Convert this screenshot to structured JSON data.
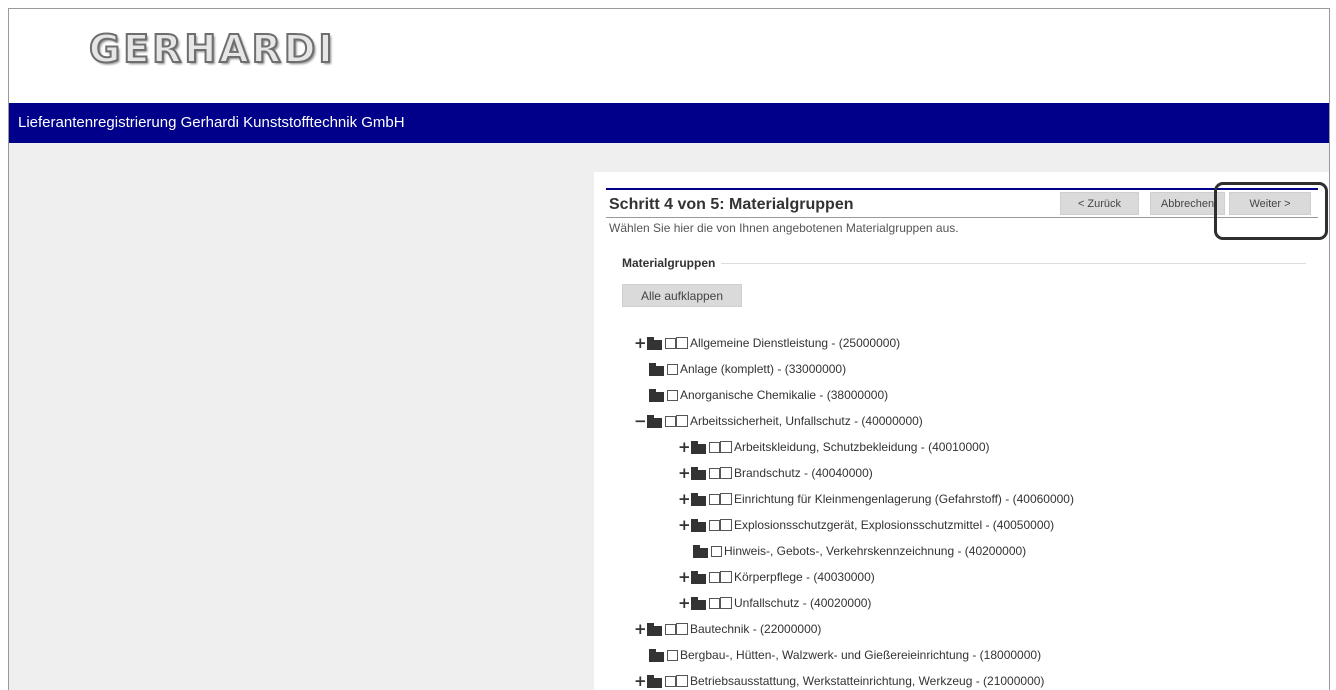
{
  "header": {
    "logo_text": "GERHARDI"
  },
  "title_bar": {
    "title": "Lieferantenregistrierung Gerhardi Kunststofftechnik GmbH"
  },
  "wizard": {
    "step_title": "Schritt 4 von 5: Materialgruppen",
    "description": "Wählen Sie hier die von Ihnen angebotenen Materialgruppen aus.",
    "back_label": "< Zurück",
    "cancel_label": "Abbrechen",
    "next_label": "Weiter >"
  },
  "section": {
    "title": "Materialgruppen",
    "expand_all_label": "Alle aufklappen"
  },
  "tree": {
    "items": [
      {
        "toggle": "+",
        "label": "Allgemeine Dienstleistung - (25000000)"
      },
      {
        "toggle": "",
        "label": "Anlage (komplett) - (33000000)"
      },
      {
        "toggle": "",
        "label": "Anorganische Chemikalie - (38000000)"
      },
      {
        "toggle": "−",
        "label": "Arbeitssicherheit, Unfallschutz - (40000000)"
      },
      {
        "toggle": "+",
        "label": "Arbeitskleidung, Schutzbekleidung - (40010000)"
      },
      {
        "toggle": "+",
        "label": "Brandschutz - (40040000)"
      },
      {
        "toggle": "+",
        "label": "Einrichtung für Kleinmengenlagerung (Gefahrstoff) - (40060000)"
      },
      {
        "toggle": "+",
        "label": "Explosionsschutzgerät, Explosionsschutzmittel - (40050000)"
      },
      {
        "toggle": "",
        "label": "Hinweis-, Gebots-, Verkehrskennzeichnung - (40200000)"
      },
      {
        "toggle": "+",
        "label": "Körperpflege - (40030000)"
      },
      {
        "toggle": "+",
        "label": "Unfallschutz - (40020000)"
      },
      {
        "toggle": "+",
        "label": "Bautechnik - (22000000)"
      },
      {
        "toggle": "",
        "label": "Bergbau-, Hütten-, Walzwerk- und Gießereieinrichtung - (18000000)"
      },
      {
        "toggle": "+",
        "label": "Betriebsausstattung, Werkstatteinrichtung, Werkzeug - (21000000)"
      }
    ]
  }
}
